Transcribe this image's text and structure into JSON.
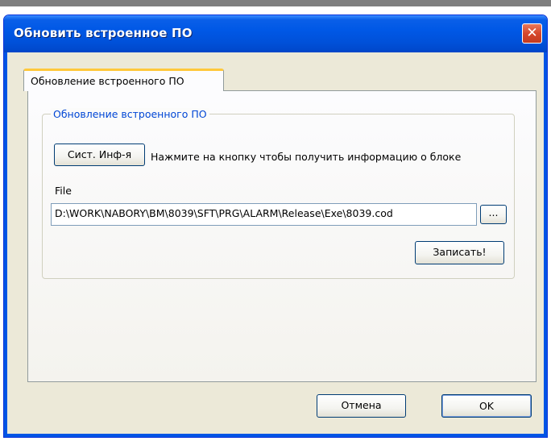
{
  "window": {
    "title": "Обновить встроенное ПО",
    "close_glyph": "✕"
  },
  "tabs": [
    {
      "label": "Обновление встроенного ПО",
      "active": true
    }
  ],
  "group": {
    "legend": "Обновление встроенного ПО",
    "sysinfo_button": "Сист. Инф-я",
    "hint": "Нажмите на кнопку чтобы получить информацию о блоке",
    "file_label": "File",
    "file_value": "D:\\WORK\\NABORY\\BM\\8039\\SFT\\PRG\\ALARM\\Release\\Exe\\8039.cod",
    "browse_button": "...",
    "write_button": "Записать!"
  },
  "footer": {
    "cancel_button": "Отмена",
    "ok_button": "OK"
  },
  "colors": {
    "titlebar": "#0055e5",
    "tab_highlight": "#ffc83c",
    "legend_text": "#0046d5",
    "dialog_bg": "#ece9d8"
  }
}
